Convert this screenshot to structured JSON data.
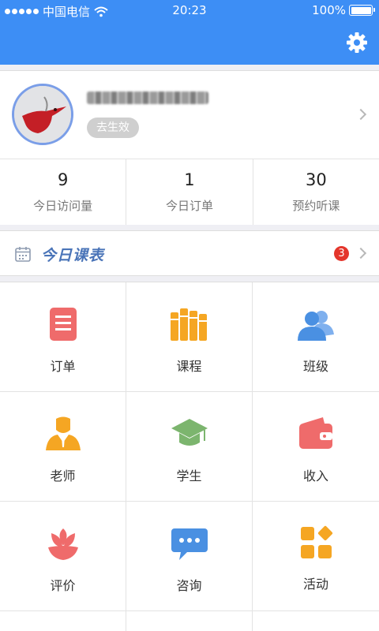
{
  "status_bar": {
    "carrier": "中国电信",
    "time": "20:23",
    "battery": "100%",
    "battery_level": 1.0
  },
  "profile": {
    "badge_label": "去生效"
  },
  "stats": [
    {
      "value": "9",
      "label": "今日访问量"
    },
    {
      "value": "1",
      "label": "今日订单"
    },
    {
      "value": "30",
      "label": "预约听课"
    }
  ],
  "schedule": {
    "title": "今日课表",
    "badge": "3"
  },
  "menu": [
    {
      "label": "订单",
      "icon": "order-icon",
      "color": "#ef6b6b"
    },
    {
      "label": "课程",
      "icon": "course-books-icon",
      "color": "#f5a623"
    },
    {
      "label": "班级",
      "icon": "class-people-icon",
      "color": "#4a90e2"
    },
    {
      "label": "老师",
      "icon": "teacher-icon",
      "color": "#f5a623"
    },
    {
      "label": "学生",
      "icon": "graduation-cap-icon",
      "color": "#7cb56e"
    },
    {
      "label": "收入",
      "icon": "wallet-icon",
      "color": "#ef6b6b"
    },
    {
      "label": "评价",
      "icon": "flower-icon",
      "color": "#ef6b6b"
    },
    {
      "label": "咨询",
      "icon": "chat-bubble-icon",
      "color": "#4a90e2"
    },
    {
      "label": "活动",
      "icon": "activity-blocks-icon",
      "color": "#f5a623"
    }
  ],
  "colors": {
    "header": "#3d8ef5",
    "badge": "#e4352b"
  }
}
